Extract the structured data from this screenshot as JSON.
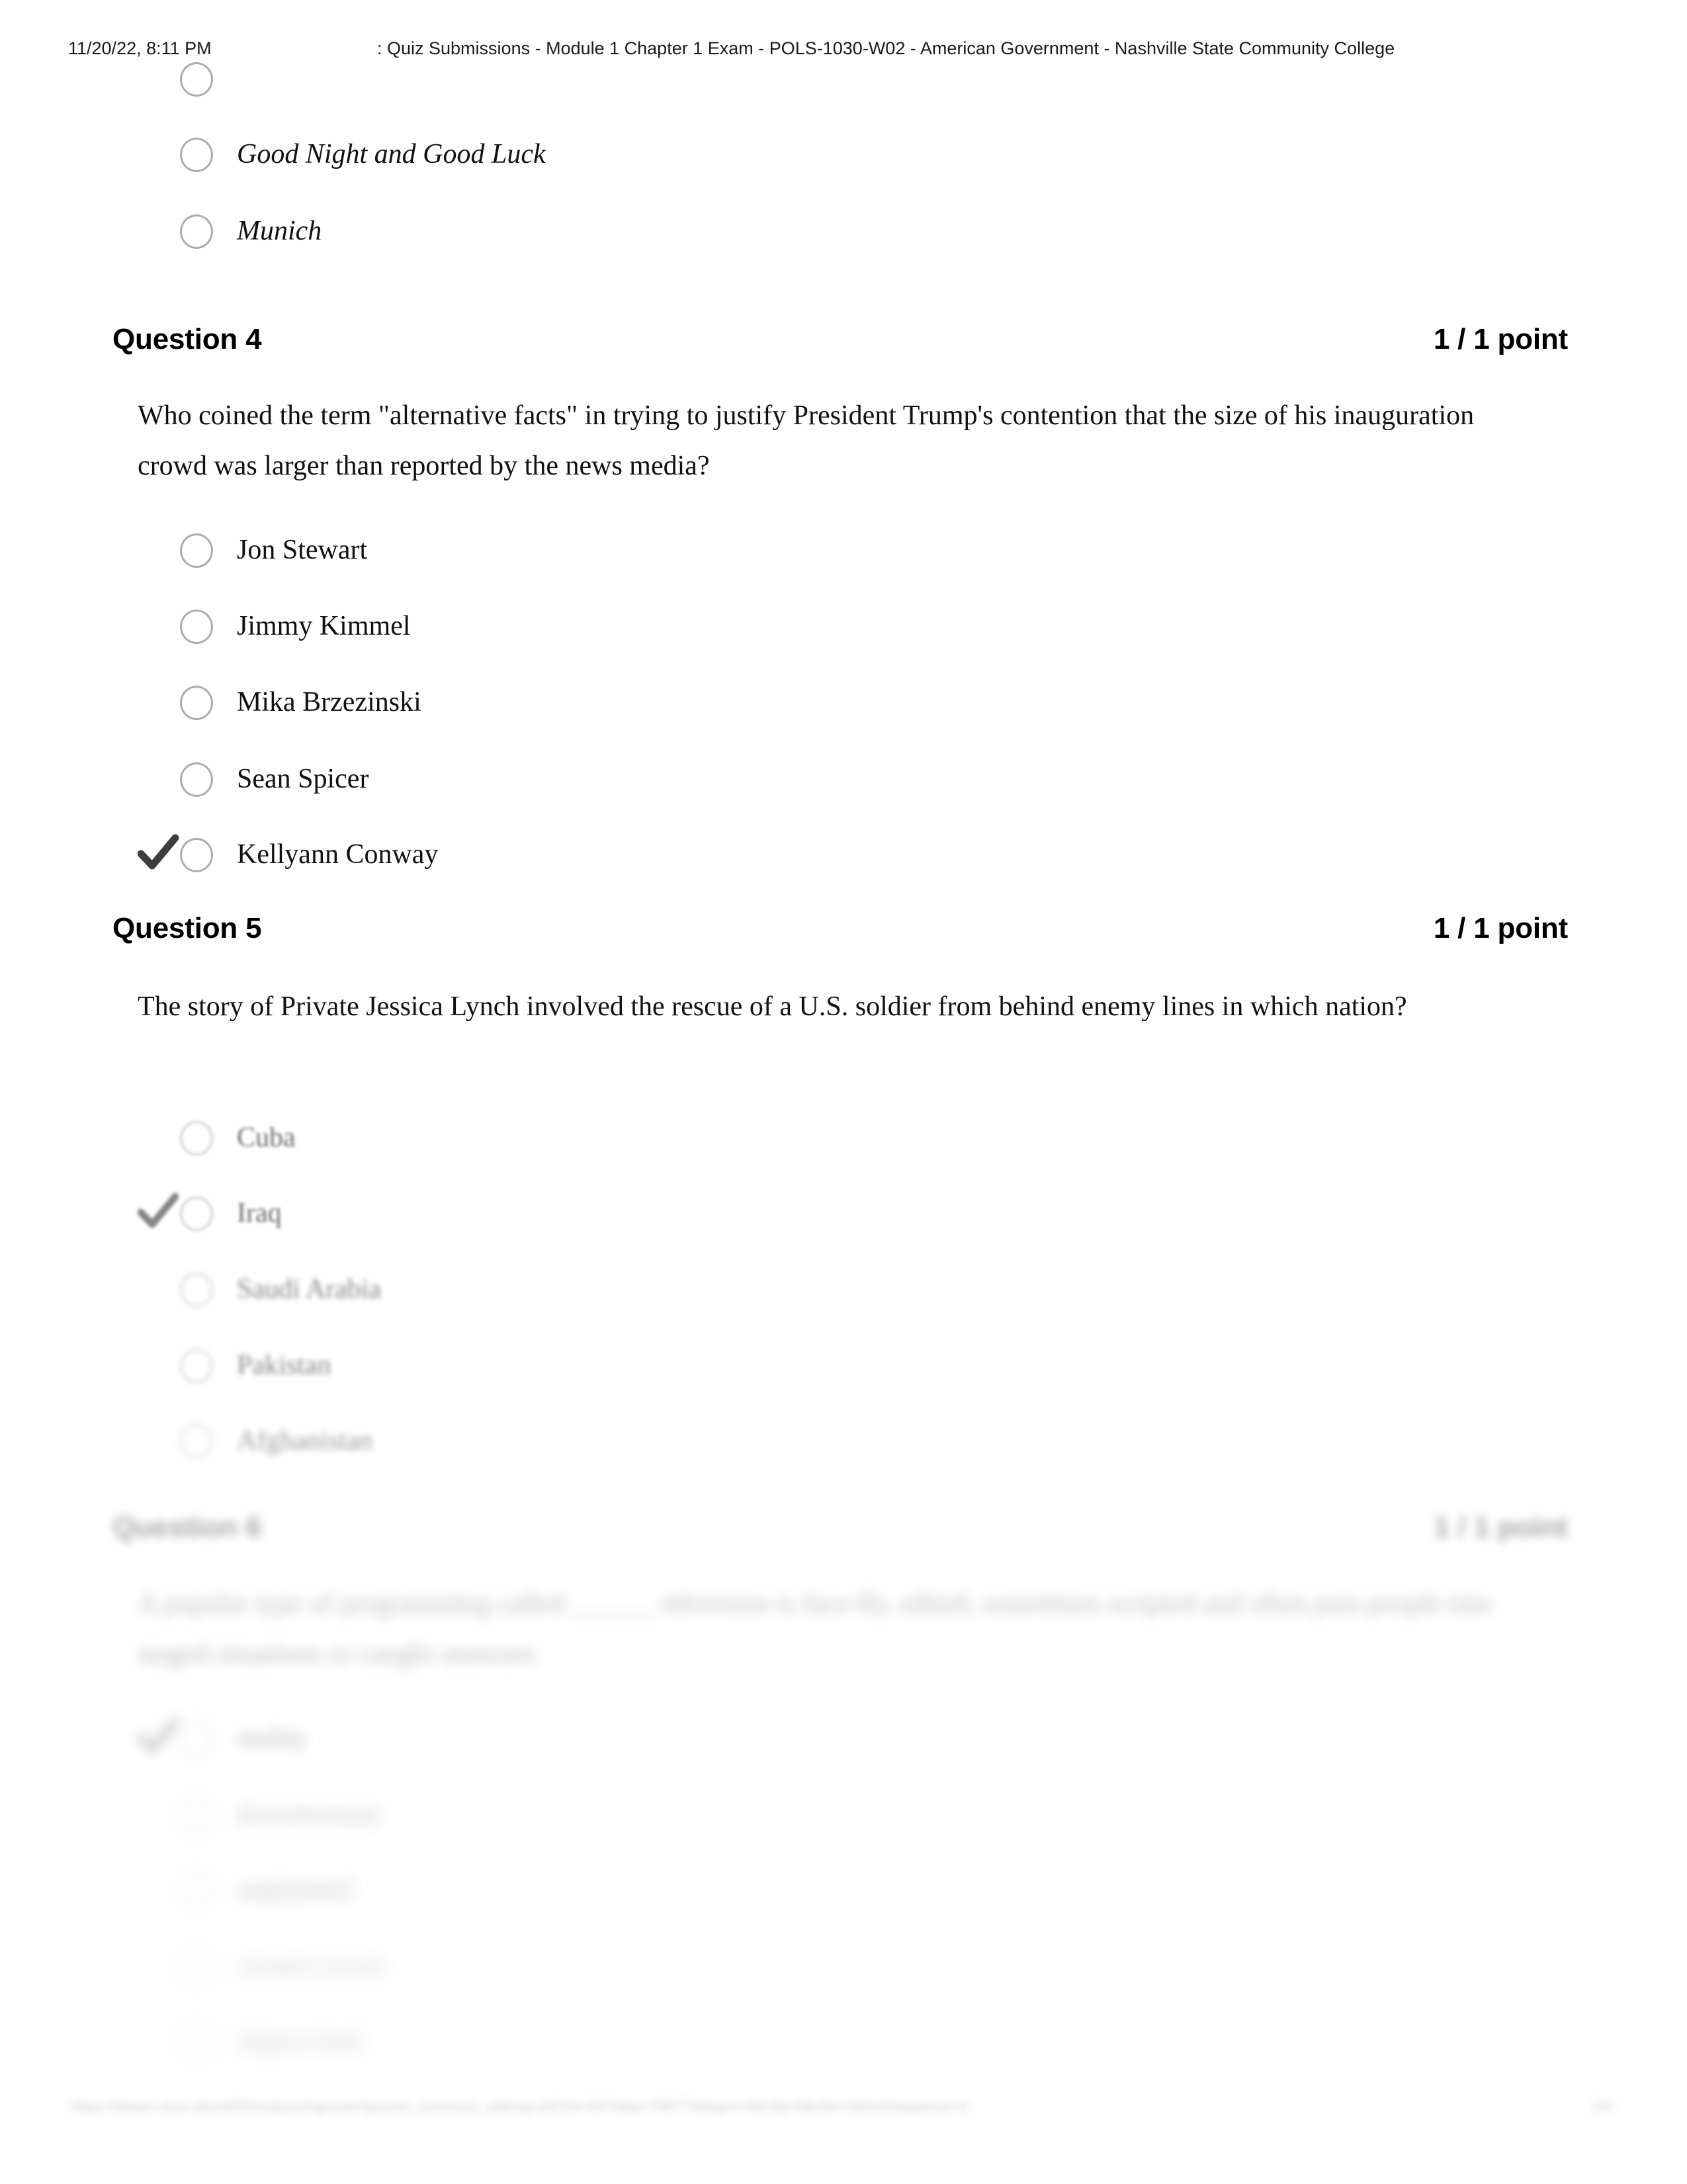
{
  "print_header": {
    "date": "11/20/22, 8:11 PM",
    "title": ": Quiz Submissions - Module 1 Chapter 1 Exam - POLS-1030-W02 - American Government - Nashville State Community College"
  },
  "print_footer": {
    "url": "https://elearn.nscc.edu/d2l/lms/quizzing/user/quizzes_summary_attempt.d2l?ai=2573&qi=706773&isprv=0&cfql=0&ofst=2&isInSequence=0",
    "page": "2/4"
  },
  "icons": {
    "correct_check": "check-icon",
    "radio_empty": "radio-unselected-icon"
  },
  "partial_question_top": {
    "options": [
      {
        "label": "",
        "italic": true,
        "selected": false
      },
      {
        "label": "Good Night and Good Luck",
        "italic": true,
        "selected": false
      },
      {
        "label": "Munich",
        "italic": true,
        "selected": false
      }
    ]
  },
  "questions": [
    {
      "id": "question-4",
      "label": "Question 4",
      "points": "1 / 1 point",
      "text": "Who coined the term \"alternative facts\" in trying to justify President Trump's contention that the size of his inauguration crowd was larger than reported by the news media?",
      "options": [
        {
          "label": "Jon Stewart",
          "selected": false
        },
        {
          "label": "Jimmy Kimmel",
          "selected": false
        },
        {
          "label": "Mika Brzezinski",
          "selected": false
        },
        {
          "label": "Sean Spicer",
          "selected": false
        },
        {
          "label": "Kellyann Conway",
          "selected": true
        }
      ]
    },
    {
      "id": "question-5",
      "label": "Question 5",
      "points": "1 / 1 point",
      "text": "The story of Private Jessica Lynch involved the rescue of a U.S. soldier from behind enemy lines in which nation?",
      "options": [
        {
          "label": "Cuba",
          "selected": false
        },
        {
          "label": "Iraq",
          "selected": true
        },
        {
          "label": "Saudi Arabia",
          "selected": false
        },
        {
          "label": "Pakistan",
          "selected": false
        },
        {
          "label": "Afghanistan",
          "selected": false
        }
      ]
    },
    {
      "id": "question-6",
      "label": "Question 6",
      "points": "1 / 1 point",
      "text": "A popular type of programming called ______ television is face-fly, edited, sometimes scripted and often puts people into staged situations or caught unaware.",
      "options": [
        {
          "label": "reality",
          "selected": true
        },
        {
          "label": "documentary",
          "selected": false
        },
        {
          "label": "unplanned",
          "selected": false
        },
        {
          "label": "closed circuit",
          "selected": false
        },
        {
          "label": "improvised",
          "selected": false
        }
      ]
    }
  ]
}
